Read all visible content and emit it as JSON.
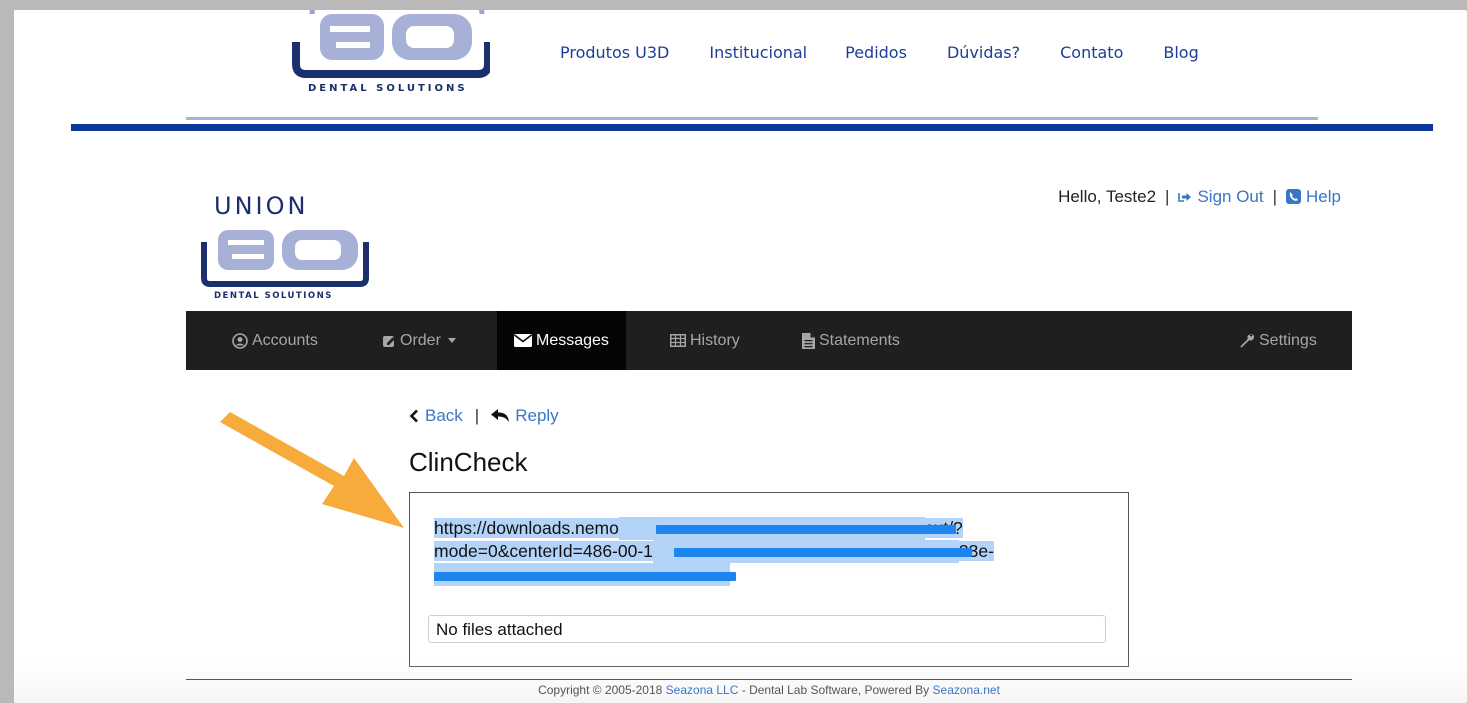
{
  "site_header": {
    "logo_text": "3D",
    "logo_subtitle": "DENTAL SOLUTIONS",
    "nav": [
      "Produtos U3D",
      "Institucional",
      "Pedidos",
      "Dúvidas?",
      "Contato",
      "Blog"
    ]
  },
  "union_logo": {
    "top_text": "UNION",
    "mark": "3D",
    "subtitle": "DENTAL SOLUTIONS"
  },
  "userbar": {
    "greeting": "Hello, Teste2",
    "separator": "|",
    "sign_out": "Sign Out",
    "help": "Help"
  },
  "mainnav": {
    "accounts": "Accounts",
    "order": "Order",
    "messages": "Messages",
    "history": "History",
    "statements": "Statements",
    "settings": "Settings"
  },
  "message": {
    "back": "Back",
    "separator": "|",
    "reply": "Reply",
    "title": "ClinCheck",
    "line1_a": "https://downloads.nemo",
    "line1_b": "cut/?",
    "line2_a": "mode=0&centerId=486-00-1",
    "line2_b": "33e-",
    "files": "No files attached"
  },
  "footer": {
    "prefix": "Copyright © 2005-2018 ",
    "company": "Seazona LLC",
    "middle": " - Dental Lab Software, Powered By ",
    "site": "Seazona.net"
  },
  "colors": {
    "link": "#3a76c5",
    "brand_navy": "#0a3799",
    "nav_bg": "#1f1f1f",
    "highlight": "#b4d3f8",
    "redaction": "#1d86ee",
    "arrow": "#f6ab3a"
  }
}
